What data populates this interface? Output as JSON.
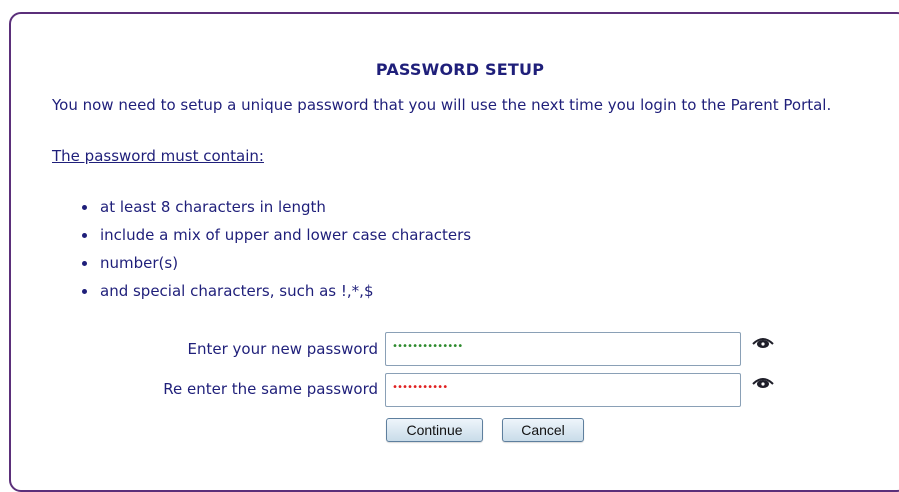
{
  "title": "PASSWORD SETUP",
  "intro": "You now need to setup a unique password that you will use the next time you login to the Parent Portal.",
  "must_heading": "The password must contain:",
  "rules": [
    "at least 8 characters in length",
    "include a mix of upper and lower case characters",
    "number(s)",
    "and special characters, such as !,*,$"
  ],
  "fields": {
    "new_password": {
      "label": "Enter your new password",
      "masked_value": "••••••••••••••",
      "mask_color": "#2e8b2e"
    },
    "confirm_password": {
      "label": "Re enter the same password",
      "masked_value": "•••••••••••",
      "mask_color": "#e02020"
    },
    "reveal_icon": "eye-icon"
  },
  "buttons": {
    "continue": "Continue",
    "cancel": "Cancel"
  },
  "colors": {
    "text": "#1f1f7a",
    "border": "#5b2f7a"
  }
}
